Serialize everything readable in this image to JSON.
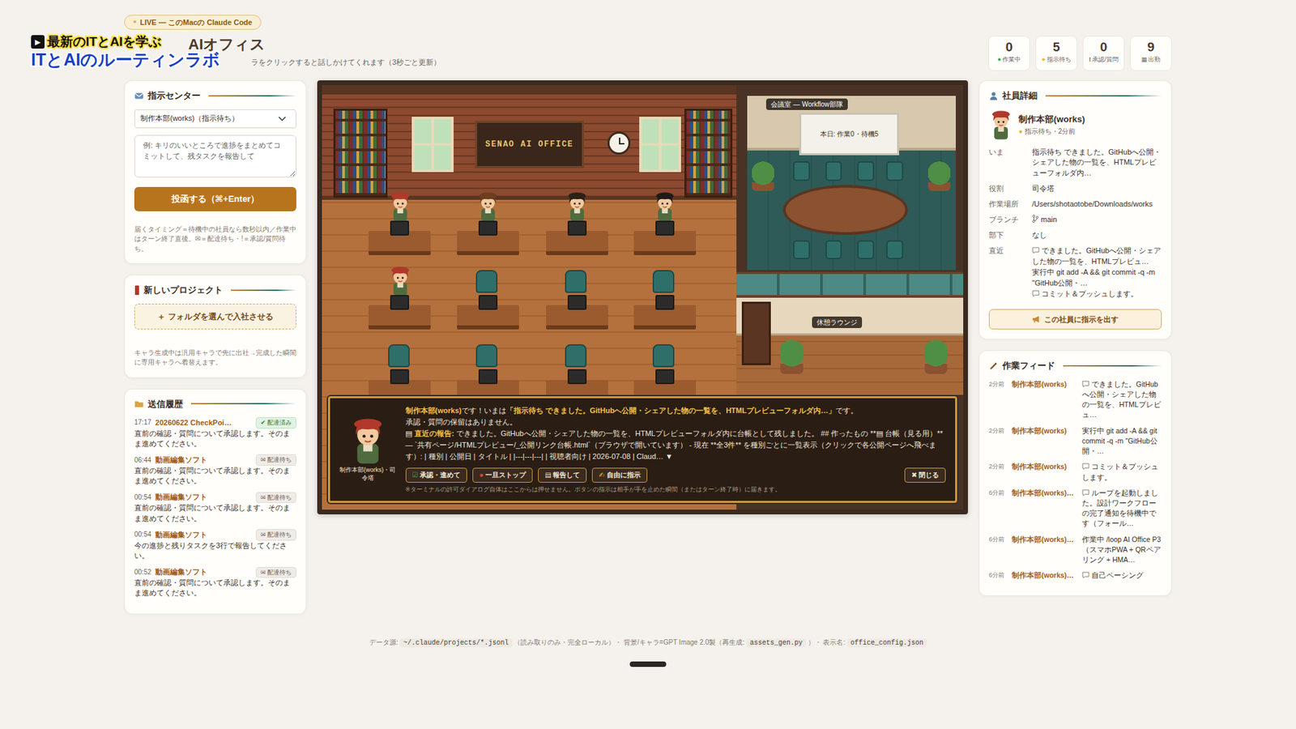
{
  "live_badge": {
    "dot": "●",
    "text": "LIVE — このMacの Claude Code"
  },
  "watermark": {
    "icon": "▶",
    "line1": "最新のITとAIを学ぶ",
    "line2": "ITとAIのルーティンラボ"
  },
  "header": {
    "title": "AIオフィス",
    "subtitle": "ラをクリックすると話しかけてくれます（3秒ごと更新）"
  },
  "stats": [
    {
      "value": "0",
      "icon": "●",
      "label": "作業中",
      "color": "#2fa84f"
    },
    {
      "value": "5",
      "icon": "●",
      "label": "指示待ち",
      "color": "#e8b923"
    },
    {
      "value": "0",
      "icon": "!",
      "label": "承認/質問",
      "color": "#d93025"
    },
    {
      "value": "9",
      "icon": "▦",
      "label": "出勤",
      "color": "#7d7268"
    }
  ],
  "command_center": {
    "title": "指示センター",
    "select": "制作本部(works)（指示待ち）",
    "placeholder": "例: キリのいいところで進捗をまとめてコミットして、残タスクを報告して",
    "button": "投函する（⌘+Enter）",
    "note": "届くタイミング＝待機中の社員なら数秒以内／作業中はターン終了直後。✉＝配達待ち・!＝承認/質問待ち。"
  },
  "new_project": {
    "title": "新しいプロジェクト",
    "button": "＋ フォルダを選んで入社させる",
    "note": "キャラ生成中は汎用キャラで先に出社→完成した瞬間に専用キャラへ着替えます。"
  },
  "history": {
    "title": "送信履歴",
    "items": [
      {
        "time": "17:17",
        "target": "20260622 CheckPoi…",
        "badge_icon": "✔",
        "status": "配達済み",
        "delivered": true,
        "text": "直前の確認・質問について承認します。そのまま進めてください。"
      },
      {
        "time": "06:44",
        "target": "動画編集ソフト",
        "badge_icon": "✉",
        "status": "配達待ち",
        "delivered": false,
        "text": "直前の確認・質問について承認します。そのまま進めてください。"
      },
      {
        "time": "00:54",
        "target": "動画編集ソフト",
        "badge_icon": "✉",
        "status": "配達待ち",
        "delivered": false,
        "text": "直前の確認・質問について承認します。そのまま進めてください。"
      },
      {
        "time": "00:54",
        "target": "動画編集ソフト",
        "badge_icon": "✉",
        "status": "配達待ち",
        "delivered": false,
        "text": "今の進捗と残りタスクを3行で報告してください。"
      },
      {
        "time": "00:52",
        "target": "動画編集ソフト",
        "badge_icon": "✉",
        "status": "配達待ち",
        "delivered": false,
        "text": "直前の確認・質問について承認します。そのまま進めてください。"
      }
    ]
  },
  "office": {
    "sign": "SENAO AI OFFICE",
    "meeting_room": "会議室 — Workflow部隊",
    "whiteboard": "本日: 作業0・待機5",
    "lounge": "休憩ラウンジ",
    "desks": [
      {
        "occupied": true,
        "color": "#b0392b"
      },
      {
        "occupied": true,
        "color": "#6b3e1f"
      },
      {
        "occupied": true,
        "color": "#2b2118"
      },
      {
        "occupied": true,
        "color": "#1f1a17"
      },
      {
        "occupied": true,
        "color": "#b0392b"
      },
      {
        "occupied": false,
        "color": "#2f6f6a"
      },
      {
        "occupied": false,
        "color": "#2f6f6a"
      },
      {
        "occupied": false,
        "color": "#2f6f6a"
      },
      {
        "occupied": false,
        "color": "#2f6f6a"
      },
      {
        "occupied": false,
        "color": "#2f6f6a"
      },
      {
        "occupied": false,
        "color": "#2f6f6a"
      },
      {
        "occupied": false,
        "color": "#2f6f6a"
      }
    ]
  },
  "dialog": {
    "portrait_label": "制作本部(works)・司令塔",
    "message": [
      {
        "text": "制作本部(works)",
        "strong": true
      },
      {
        "text": "です！いまは",
        "strong": false
      },
      {
        "text": "「指示待ち できました。GitHubへ公開・シェアした物の一覧を、HTMLプレビューフォルダ内…」",
        "strong": true
      },
      {
        "text": "です。",
        "strong": false
      }
    ],
    "pending": "承認・質問の保留はありません。",
    "report_icon": "▤",
    "report_label": "直近の報告:",
    "report": "できました。GitHubへ公開・シェアした物の一覧を、HTMLプレビューフォルダ内に台帳として残しました。 ## 作ったもの **▤ 台帳（見る用）** — `共有ページ/HTMLプレビュー/_公開リンク台帳.html`（ブラウザで開いています） - 現在 **全3件** を種別ごとに一覧表示（クリックで各公開ページへ飛べます）: | 種別 | 公開日 | タイトル | |---|---|---| | 視聴者向け | 2026-07-08 | Claud…",
    "expand": "▼",
    "buttons": [
      {
        "icon": "☑",
        "label": "承認・進めて",
        "color": "#3fae5a"
      },
      {
        "icon": "●",
        "label": "一旦ストップ",
        "color": "#e0443a"
      },
      {
        "icon": "▤",
        "label": "報告して",
        "color": "#e8e0d0"
      },
      {
        "icon": "✍",
        "label": "自由に指示",
        "color": "#e8b923"
      }
    ],
    "close": {
      "icon": "✖",
      "label": "閉じる"
    },
    "footnote": "※ターミナルの許可ダイアログ自体はここからは押せません。ボタンの指示は相手が手を止めた瞬間（またはターン終了時）に届きます。"
  },
  "employee": {
    "title": "社員詳細",
    "name": "制作本部(works)",
    "status_dot": "●",
    "status": "指示待ち・2分前",
    "status_color": "#e8b923",
    "rows": [
      {
        "label": "いま",
        "lines": [
          {
            "kind": "text",
            "text": "指示待ち できました。GitHubへ公開・シェアした物の一覧を、HTMLプレビューフォルダ内…"
          }
        ]
      },
      {
        "label": "役割",
        "lines": [
          {
            "kind": "text",
            "text": "司令塔"
          }
        ]
      },
      {
        "label": "作業場所",
        "lines": [
          {
            "kind": "text",
            "text": "/Users/shotaotobe/Downloads/works"
          }
        ]
      },
      {
        "label": "ブランチ",
        "lines": [
          {
            "kind": "branch",
            "text": "main"
          }
        ]
      },
      {
        "label": "部下",
        "lines": [
          {
            "kind": "text",
            "text": "なし"
          }
        ]
      },
      {
        "label": "直近",
        "lines": [
          {
            "kind": "say",
            "text": "できました。GitHubへ公開・シェアした物の一覧を、HTMLプレビュ…"
          },
          {
            "kind": "text",
            "text": "実行中 git add -A && git commit -q -m \"GitHub公開・…"
          },
          {
            "kind": "say",
            "text": "コミット＆プッシュします。"
          }
        ]
      }
    ],
    "button": "この社員に指示を出す"
  },
  "feed": {
    "title": "作業フィード",
    "items": [
      {
        "time": "2分前",
        "name": "制作本部(works)",
        "kind": "say",
        "text": "できました。GitHubへ公開・シェアした物の一覧を、HTMLプレビュ…"
      },
      {
        "time": "2分前",
        "name": "制作本部(works)",
        "kind": "text",
        "text": "実行中 git add -A && git commit -q -m \"GitHub公開・…"
      },
      {
        "time": "2分前",
        "name": "制作本部(works)",
        "kind": "say",
        "text": "コミット＆プッシュします。"
      },
      {
        "time": "6分前",
        "name": "制作本部(works)…",
        "kind": "say",
        "text": "ループを起動しました。設計ワークフローの完了通知を待機中です（フォール…"
      },
      {
        "time": "6分前",
        "name": "制作本部(works)…",
        "kind": "text",
        "text": "作業中 /loop AI Office P3（スマホPWA + QRペアリング + HMA…"
      },
      {
        "time": "6分前",
        "name": "制作本部(works)…",
        "kind": "say",
        "text": "自己ペーシング"
      }
    ]
  },
  "footer": [
    {
      "text": "データ源:",
      "code": false
    },
    {
      "text": "~/.claude/projects/*.jsonl",
      "code": true
    },
    {
      "text": "（読み取りのみ・完全ローカル）・ 背景/キャラ=GPT Image 2.0製（再生成:",
      "code": false
    },
    {
      "text": "assets_gen.py",
      "code": true
    },
    {
      "text": "）・ 表示名:",
      "code": false
    },
    {
      "text": "office_config.json",
      "code": true
    }
  ]
}
